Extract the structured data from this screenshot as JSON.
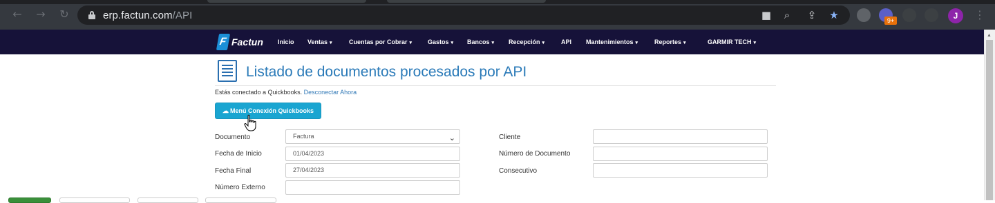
{
  "browser": {
    "url_host": "erp.factun.com",
    "url_path": "/API",
    "extension_badge": "9+",
    "profile_initial": "J"
  },
  "navbar": {
    "brand": "Factun",
    "items": [
      {
        "label": "Inicio",
        "dropdown": false
      },
      {
        "label": "Ventas",
        "dropdown": true
      },
      {
        "label": "Cuentas por Cobrar",
        "dropdown": true
      },
      {
        "label": "Gastos",
        "dropdown": true
      },
      {
        "label": "Bancos",
        "dropdown": true
      },
      {
        "label": "Recepción",
        "dropdown": true
      },
      {
        "label": "API",
        "dropdown": false
      },
      {
        "label": "Mantenimientos",
        "dropdown": true
      },
      {
        "label": "Reportes",
        "dropdown": true
      },
      {
        "label": "GARMIR TECH",
        "dropdown": true
      }
    ]
  },
  "page": {
    "title": "Listado de documentos procesados por API",
    "connection_text": "Estás conectado a Quickbooks.",
    "disconnect_link": "Desconectar Ahora",
    "qb_button": "Menú Conexión Quickbooks"
  },
  "filters": {
    "documento": {
      "label": "Documento",
      "value": "Factura"
    },
    "fecha_inicio": {
      "label": "Fecha de Inicio",
      "value": "01/04/2023"
    },
    "fecha_final": {
      "label": "Fecha Final",
      "value": "27/04/2023"
    },
    "numero_externo": {
      "label": "Número Externo",
      "value": ""
    },
    "cliente": {
      "label": "Cliente",
      "value": ""
    },
    "numero_documento": {
      "label": "Número de Documento",
      "value": ""
    },
    "consecutivo": {
      "label": "Consecutivo",
      "value": ""
    }
  },
  "colors": {
    "navbar_bg": "#161239",
    "accent": "#1aa5d1",
    "title": "#2a7ab8",
    "link": "#337ab7"
  }
}
